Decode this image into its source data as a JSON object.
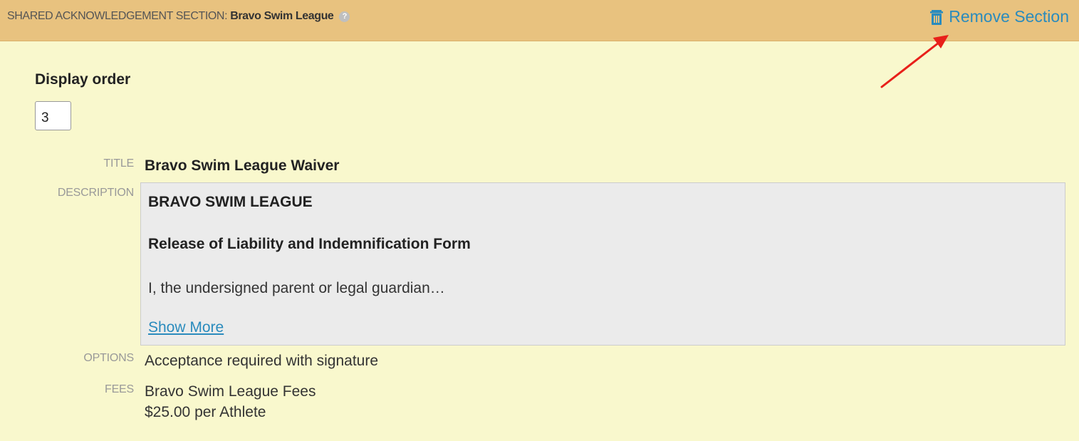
{
  "header": {
    "section_prefix": "SHARED ACKNOWLEDGEMENT SECTION:",
    "section_name": "Bravo Swim League",
    "help_icon": "question-circle-icon",
    "help_glyph": "?",
    "remove_label": "Remove Section",
    "remove_icon": "trash-icon"
  },
  "display_order": {
    "label": "Display order",
    "value": "3"
  },
  "fields": {
    "title_label": "TITLE",
    "title_value": "Bravo Swim League Waiver",
    "description_label": "DESCRIPTION",
    "description": {
      "heading": "BRAVO SWIM LEAGUE",
      "subheading": "Release of Liability and Indemnification Form",
      "body": "I, the undersigned parent or legal guardian…",
      "show_more": "Show More"
    },
    "options_label": "OPTIONS",
    "options_value": "Acceptance required with signature",
    "fees_label": "FEES",
    "fees_name": "Bravo Swim League Fees",
    "fees_amount": "$25.00 per Athlete"
  },
  "colors": {
    "header_bg": "#e8c27f",
    "section_bg": "#f9f8cd",
    "link": "#2a8bbd",
    "annotation_arrow": "#e8201a"
  }
}
